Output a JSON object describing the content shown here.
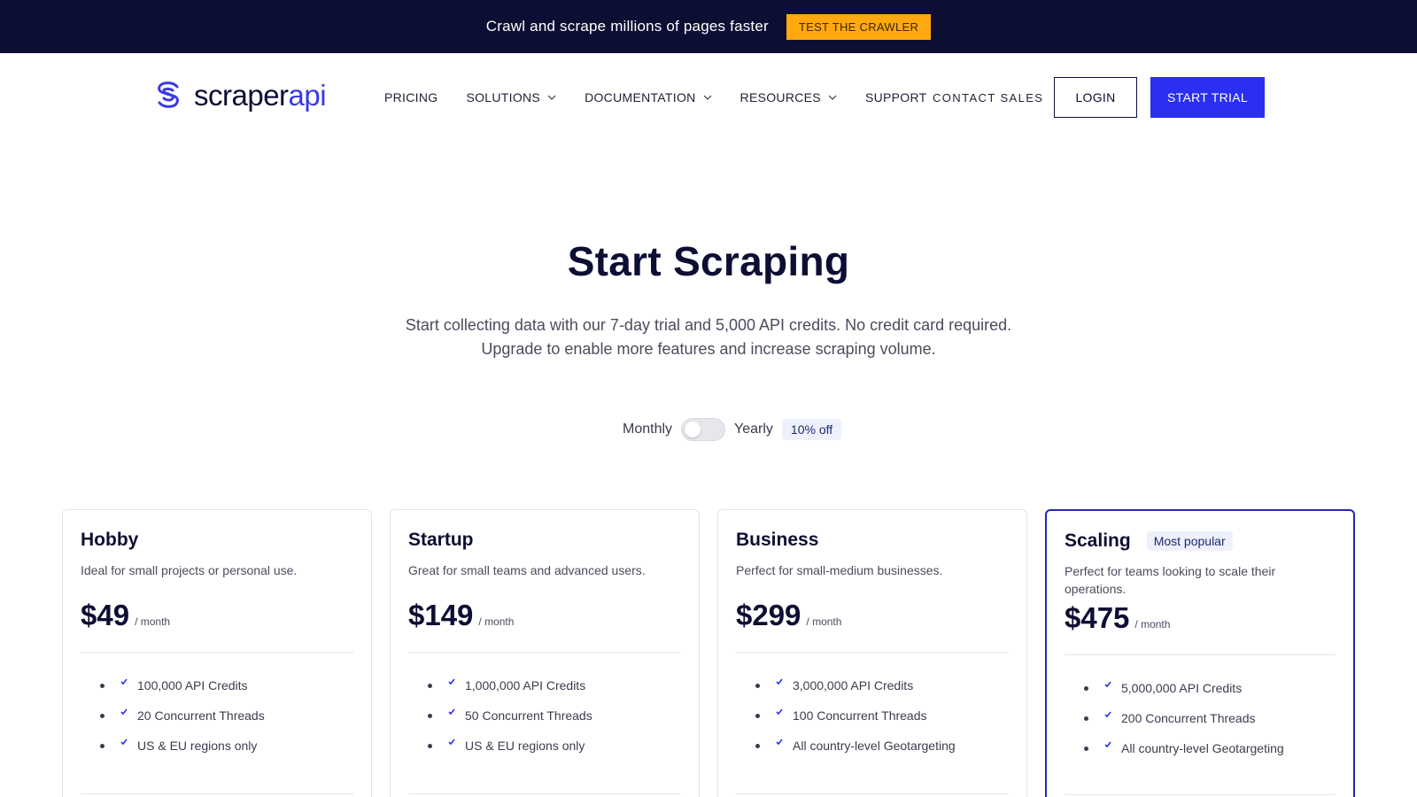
{
  "topbar": {
    "text": "Crawl and scrape millions of pages faster",
    "cta": "TEST THE CRAWLER"
  },
  "brand": {
    "name_part1": "scraper",
    "name_part2": "api",
    "colors": {
      "dark": "#0d0e33",
      "accent": "#3b3ae8",
      "cta_yellow": "#ffa80f",
      "primary_button": "#2b2ff0"
    }
  },
  "nav": {
    "items": [
      {
        "label": "PRICING",
        "has_dropdown": false
      },
      {
        "label": "SOLUTIONS",
        "has_dropdown": true
      },
      {
        "label": "DOCUMENTATION",
        "has_dropdown": true
      },
      {
        "label": "RESOURCES",
        "has_dropdown": true
      },
      {
        "label": "SUPPORT",
        "has_dropdown": false
      }
    ],
    "contact": "CONTACT SALES",
    "login": "LOGIN",
    "trial": "START TRIAL"
  },
  "hero": {
    "title": "Start Scraping",
    "subtitle_line1": "Start collecting data with our 7-day trial and 5,000 API credits. No credit card required.",
    "subtitle_line2": "Upgrade to enable more features and increase scraping volume."
  },
  "billing": {
    "monthly": "Monthly",
    "yearly": "Yearly",
    "discount": "10% off",
    "yearly_selected": false
  },
  "plans": [
    {
      "name": "Hobby",
      "badge": "",
      "description": "Ideal for small projects or personal use.",
      "price": "$49",
      "period": "/ month",
      "features": [
        "100,000 API Credits",
        "20 Concurrent Threads",
        "US & EU regions only"
      ]
    },
    {
      "name": "Startup",
      "badge": "",
      "description": "Great for small teams and advanced users.",
      "price": "$149",
      "period": "/ month",
      "features": [
        "1,000,000 API Credits",
        "50 Concurrent Threads",
        "US & EU regions only"
      ]
    },
    {
      "name": "Business",
      "badge": "",
      "description": "Perfect for small-medium businesses.",
      "price": "$299",
      "period": "/ month",
      "features": [
        "3,000,000 API Credits",
        "100 Concurrent Threads",
        "All country-level Geotargeting"
      ]
    },
    {
      "name": "Scaling",
      "badge": "Most popular",
      "description": "Perfect for teams looking to scale their operations.",
      "price": "$475",
      "period": "/ month",
      "features": [
        "5,000,000 API Credits",
        "200 Concurrent Threads",
        "All country-level Geotargeting"
      ]
    }
  ]
}
